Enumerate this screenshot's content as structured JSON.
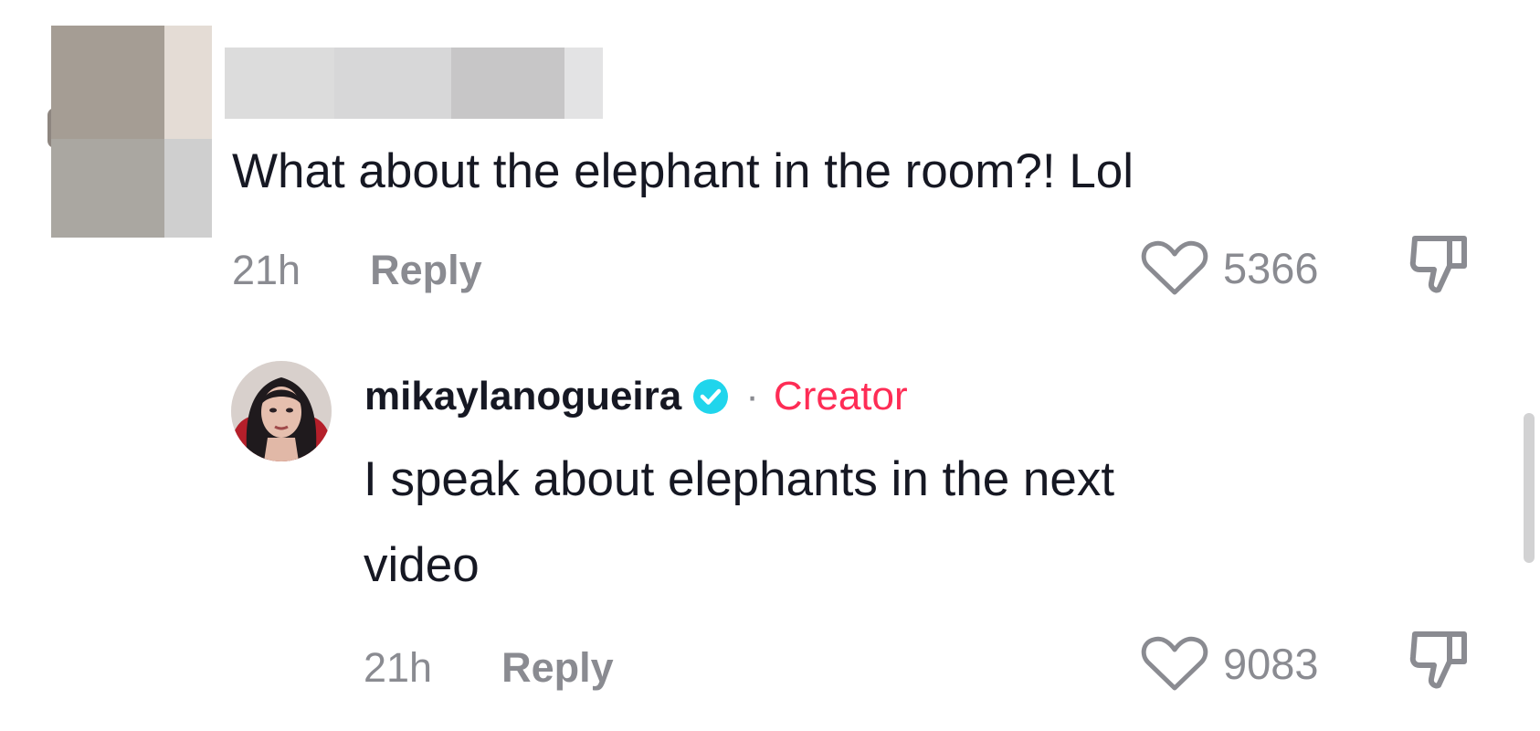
{
  "comments": [
    {
      "text": "What about the elephant in the room?! Lol",
      "time": "21h",
      "reply_label": "Reply",
      "likes": "5366"
    },
    {
      "username": "mikaylanogueira",
      "separator": "·",
      "badge": "Creator",
      "text_line1": "I speak about elephants in the next",
      "text_line2": "video",
      "time": "21h",
      "reply_label": "Reply",
      "likes": "9083"
    }
  ],
  "icons": {
    "like": "heart-outline-icon",
    "dislike": "thumbs-down-icon",
    "verified": "verified-badge-icon"
  },
  "colors": {
    "text": "#161823",
    "muted": "#8a8b91",
    "creator": "#fe2c55",
    "verified": "#20d5ec"
  }
}
